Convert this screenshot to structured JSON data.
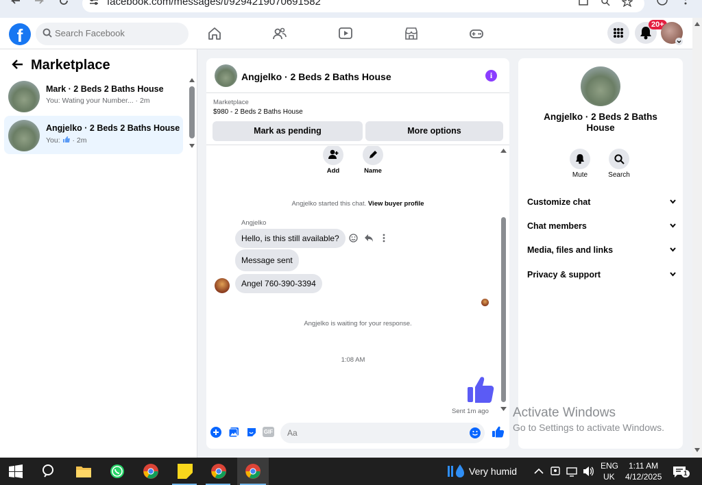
{
  "browser": {
    "url": "facebook.com/messages/t/9294219070691582"
  },
  "topbar": {
    "logo": "f",
    "search_placeholder": "Search Facebook",
    "notifications_badge": "20+"
  },
  "left": {
    "title": "Marketplace",
    "conversations": [
      {
        "name": "Mark · 2 Beds 2 Baths House",
        "preview": "You: Wating your Number... · 2m",
        "active": false
      },
      {
        "name": "Angjelko · 2 Beds 2 Baths House",
        "preview_prefix": "You:",
        "preview_suffix": "· 2m",
        "active": true
      }
    ]
  },
  "chat": {
    "title": "Angjelko · 2 Beds 2 Baths House",
    "marketplace_label": "Marketplace",
    "listing": "$980 - 2 Beds 2 Baths House",
    "mark_pending": "Mark as pending",
    "more_options": "More options",
    "actions": [
      {
        "label": "Add",
        "icon": "add-person-icon"
      },
      {
        "label": "Name",
        "icon": "pencil-icon"
      }
    ],
    "started_text": "Angjelko started this chat.",
    "view_profile": "View buyer profile",
    "sender": "Angjelko",
    "messages": [
      "Hello, is this still available?",
      "Message sent",
      "Angel 760-390-3394"
    ],
    "waiting_text": "Angjelko is waiting for your response.",
    "timestamp": "1:08 AM",
    "sent_label": "Sent 1m ago",
    "composer_placeholder": "Aa",
    "gif_label": "GIF"
  },
  "right": {
    "name": "Angjelko · 2 Beds 2 Baths House",
    "mute": "Mute",
    "search": "Search",
    "sections": [
      "Customize chat",
      "Chat members",
      "Media, files and links",
      "Privacy & support"
    ]
  },
  "watermark": {
    "title": "Activate Windows",
    "subtitle": "Go to Settings to activate Windows."
  },
  "taskbar": {
    "weather": "Very humid",
    "lang1": "ENG",
    "lang2": "UK",
    "time": "1:11 AM",
    "date": "4/12/2025",
    "notif_count": "1"
  },
  "colors": {
    "fb_blue": "#1877f2",
    "like_purple": "#5b5bf5",
    "active_bg": "#ebf5ff"
  }
}
